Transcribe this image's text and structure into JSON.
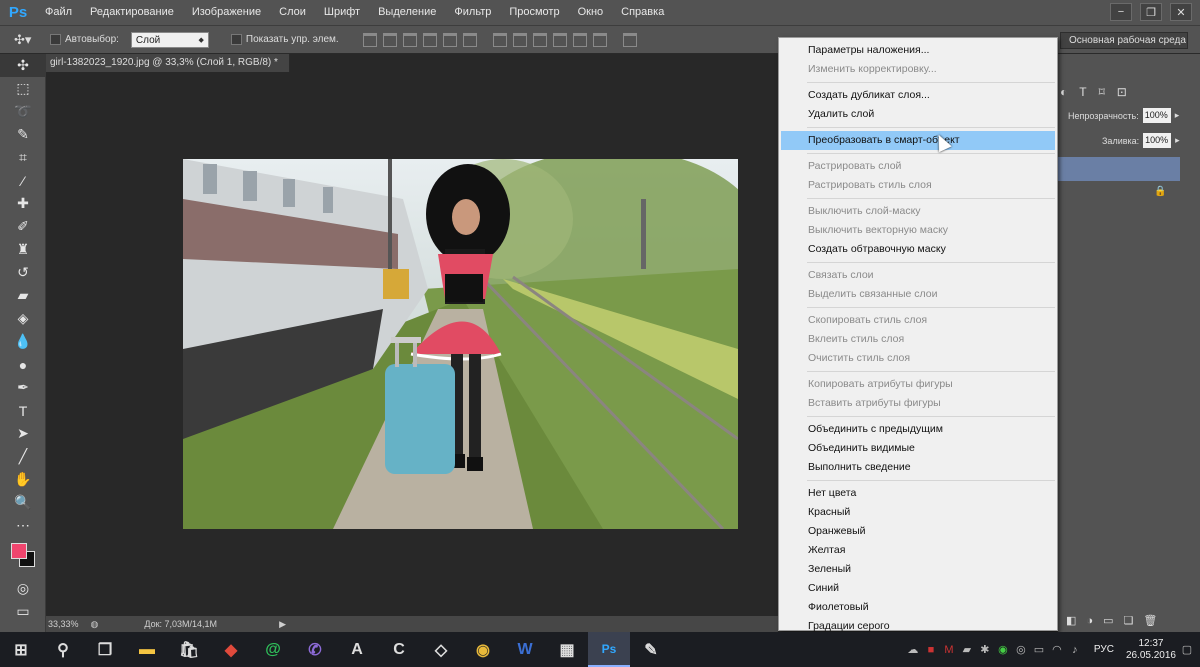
{
  "app": {
    "logo": "Ps"
  },
  "menubar": {
    "items": [
      "Файл",
      "Редактирование",
      "Изображение",
      "Слои",
      "Шрифт",
      "Выделение",
      "Фильтр",
      "Просмотр",
      "Окно",
      "Справка"
    ],
    "window_controls": [
      "−",
      "❐",
      "✕"
    ]
  },
  "options": {
    "autoselect_label": "Автовыбор:",
    "autoselect_value": "Слой",
    "show_controls_label": "Показать упр. элем.",
    "workspace": "Основная рабочая среда"
  },
  "document": {
    "tab_title": "girl-1382023_1920.jpg @ 33,3% (Слой 1, RGB/8) *",
    "zoom": "33,33%",
    "doc_size": "Док: 7,03M/14,1M"
  },
  "colors": {
    "foreground": "#f0456e",
    "background": "#111111",
    "menu_highlight": "#91c9f7"
  },
  "right_panel": {
    "opacity_label": "Непрозрачность:",
    "opacity_value": "100%",
    "fill_label": "Заливка:",
    "fill_value": "100%"
  },
  "context_menu": {
    "groups": [
      [
        {
          "label": "Параметры наложения...",
          "enabled": true
        },
        {
          "label": "Изменить корректировку...",
          "enabled": false
        }
      ],
      [
        {
          "label": "Создать дубликат слоя...",
          "enabled": true
        },
        {
          "label": "Удалить слой",
          "enabled": true
        }
      ],
      [
        {
          "label": "Преобразовать в смарт-объект",
          "enabled": true,
          "highlighted": true
        }
      ],
      [
        {
          "label": "Растрировать слой",
          "enabled": false
        },
        {
          "label": "Растрировать стиль слоя",
          "enabled": false
        }
      ],
      [
        {
          "label": "Выключить слой-маску",
          "enabled": false
        },
        {
          "label": "Выключить векторную маску",
          "enabled": false
        },
        {
          "label": "Создать обтравочную маску",
          "enabled": true
        }
      ],
      [
        {
          "label": "Связать слои",
          "enabled": false
        },
        {
          "label": "Выделить связанные слои",
          "enabled": false
        }
      ],
      [
        {
          "label": "Скопировать стиль слоя",
          "enabled": false
        },
        {
          "label": "Вклеить стиль слоя",
          "enabled": false
        },
        {
          "label": "Очистить стиль слоя",
          "enabled": false
        }
      ],
      [
        {
          "label": "Копировать атрибуты фигуры",
          "enabled": false
        },
        {
          "label": "Вставить атрибуты фигуры",
          "enabled": false
        }
      ],
      [
        {
          "label": "Объединить с предыдущим",
          "enabled": true
        },
        {
          "label": "Объединить видимые",
          "enabled": true
        },
        {
          "label": "Выполнить сведение",
          "enabled": true
        }
      ],
      [
        {
          "label": "Нет цвета",
          "enabled": true
        },
        {
          "label": "Красный",
          "enabled": true
        },
        {
          "label": "Оранжевый",
          "enabled": true
        },
        {
          "label": "Желтая",
          "enabled": true
        },
        {
          "label": "Зеленый",
          "enabled": true
        },
        {
          "label": "Синий",
          "enabled": true
        },
        {
          "label": "Фиолетовый",
          "enabled": true
        },
        {
          "label": "Градации серого",
          "enabled": true
        }
      ]
    ]
  },
  "taskbar": {
    "language": "РУС",
    "time": "12:37",
    "date": "26.05.2016"
  }
}
